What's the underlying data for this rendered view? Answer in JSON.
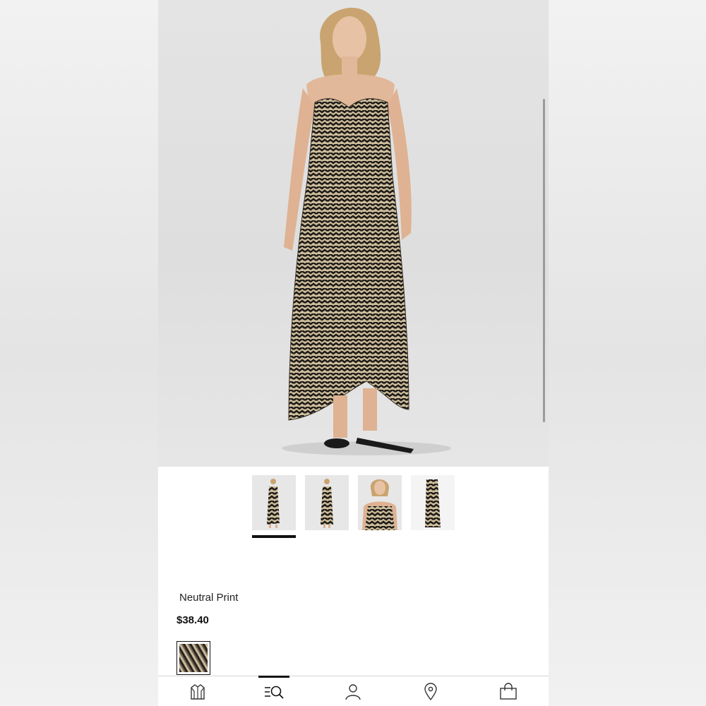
{
  "product": {
    "color_name": "Neutral Print",
    "price": "$38.40"
  },
  "gallery": {
    "thumbnails": [
      "front-full",
      "back-full",
      "front-closeup",
      "flat-lay"
    ],
    "selected_index": 0
  },
  "bottom_nav": {
    "items": [
      "shop-icon",
      "search-menu-icon",
      "account-icon",
      "store-locator-icon",
      "bag-icon"
    ],
    "active_index": 1
  },
  "colors": {
    "accent": "#111111",
    "background": "#ffffff"
  }
}
